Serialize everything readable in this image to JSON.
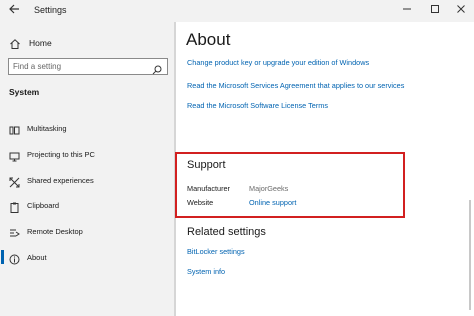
{
  "window": {
    "title": "Settings",
    "back_icon": "arrow-left-icon",
    "controls": [
      "minimize-icon",
      "maximize-icon",
      "close-icon"
    ]
  },
  "sidebar": {
    "home_label": "Home",
    "search_placeholder": "Find a setting",
    "section_label": "System",
    "items": [
      {
        "label": "Multitasking",
        "icon": "multitasking-icon",
        "selected": false
      },
      {
        "label": "Projecting to this PC",
        "icon": "projecting-icon",
        "selected": false
      },
      {
        "label": "Shared experiences",
        "icon": "shared-experiences-icon",
        "selected": false
      },
      {
        "label": "Clipboard",
        "icon": "clipboard-icon",
        "selected": false
      },
      {
        "label": "Remote Desktop",
        "icon": "remote-desktop-icon",
        "selected": false
      },
      {
        "label": "About",
        "icon": "info-icon",
        "selected": true
      }
    ]
  },
  "main": {
    "title": "About",
    "links": [
      "Change product key or upgrade your edition of Windows",
      "Read the Microsoft Services Agreement that applies to our services",
      "Read the Microsoft Software License Terms"
    ],
    "support": {
      "title": "Support",
      "manufacturer_label": "Manufacturer",
      "manufacturer_value": "MajorGeeks",
      "website_label": "Website",
      "website_value": "Online support"
    },
    "related": {
      "title": "Related settings",
      "links": [
        "BitLocker settings",
        "System info"
      ]
    }
  },
  "colors": {
    "accent": "#0063b1",
    "highlight_border": "#d22020",
    "sidebar_bg": "#f2f2f2"
  }
}
